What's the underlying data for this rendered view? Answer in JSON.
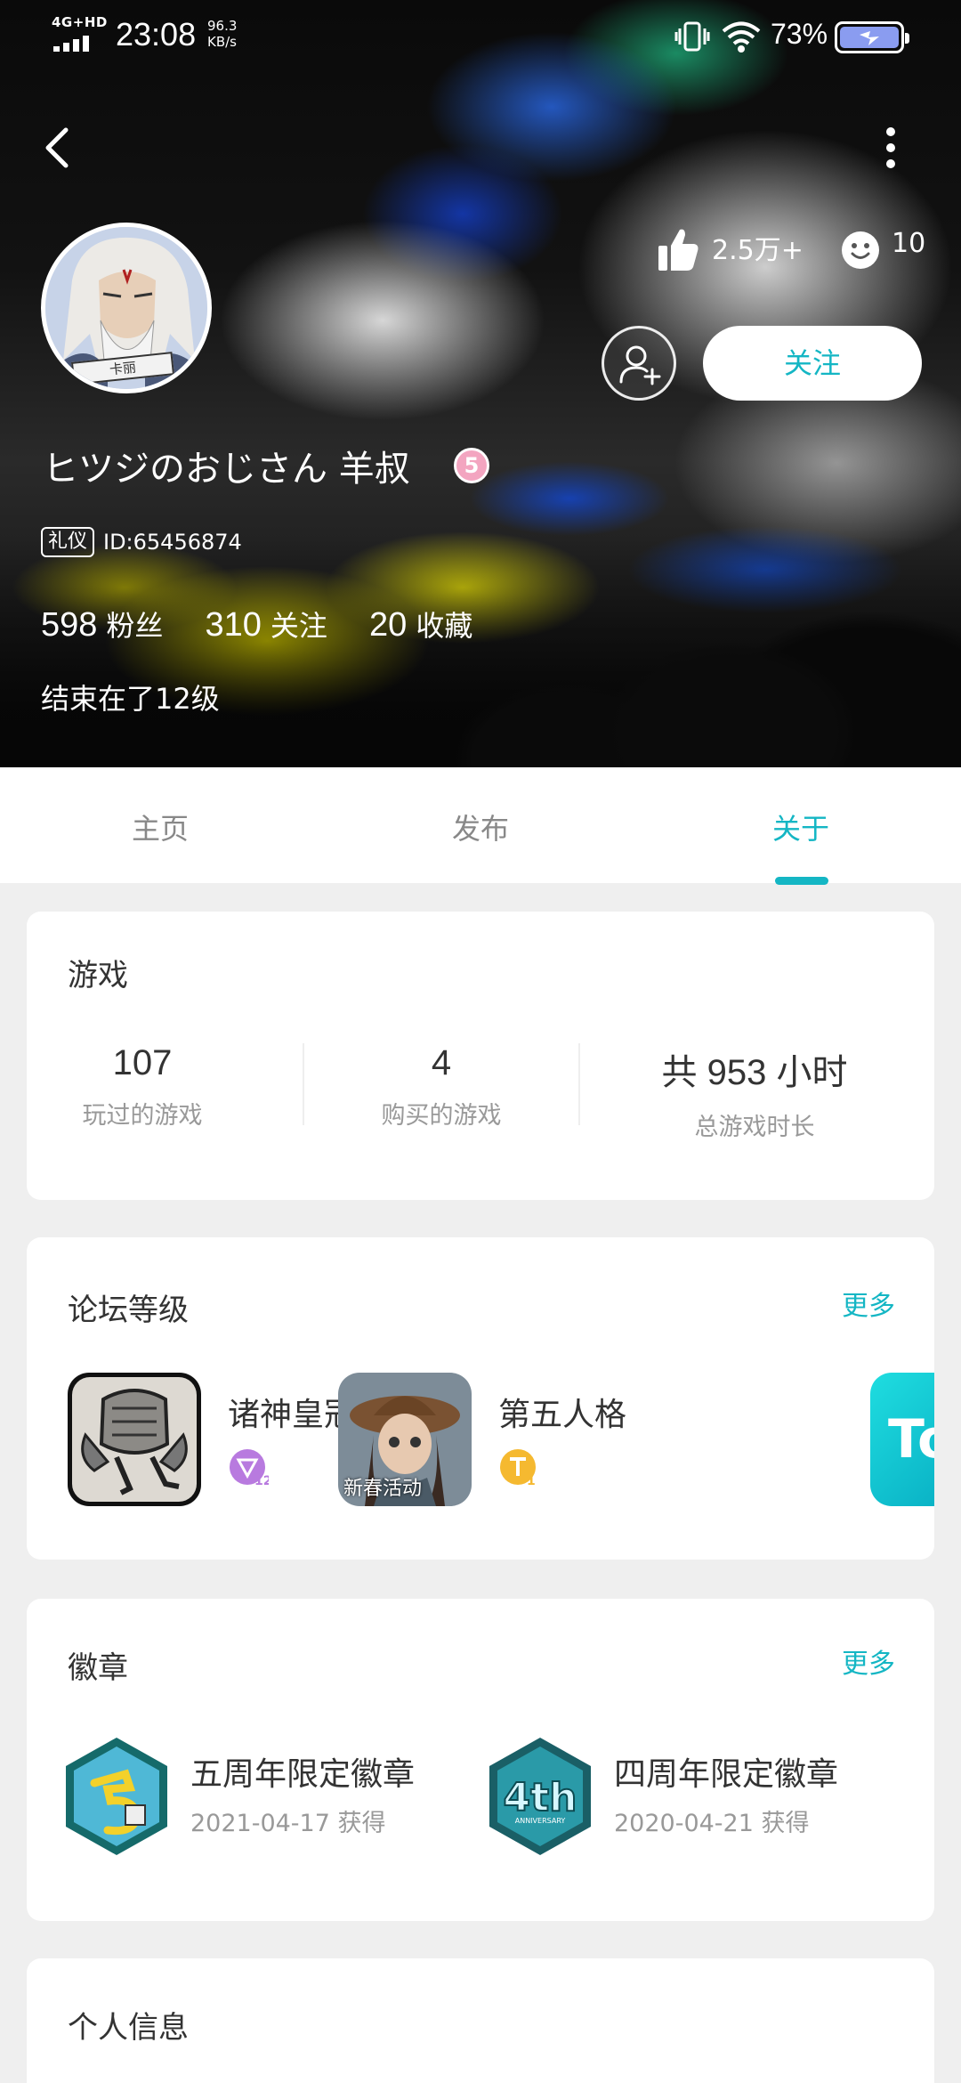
{
  "status_bar": {
    "network": "4G+HD",
    "time": "23:08",
    "speed_value": "96.3",
    "speed_unit": "KB/s",
    "battery": "73%"
  },
  "profile": {
    "likes": "2.5万+",
    "faces": "10",
    "follow_label": "关注",
    "name": "ヒツジのおじさん 羊叔",
    "level": "5",
    "title_badge": "礼仪",
    "user_id": "ID:65456874",
    "avatar_tag": "卡丽",
    "stats": [
      {
        "num": "598",
        "label": "粉丝"
      },
      {
        "num": "310",
        "label": "关注"
      },
      {
        "num": "20",
        "label": "收藏"
      }
    ],
    "bio": "结束在了12级"
  },
  "tabs": [
    {
      "label": "主页",
      "active": false
    },
    {
      "label": "发布",
      "active": false
    },
    {
      "label": "关于",
      "active": true
    }
  ],
  "games": {
    "title": "游戏",
    "stats": [
      {
        "num": "107",
        "label": "玩过的游戏"
      },
      {
        "num": "4",
        "label": "购买的游戏"
      },
      {
        "num": "共 953 小时",
        "label": "总游戏时长"
      }
    ]
  },
  "forum": {
    "title": "论坛等级",
    "more": "更多",
    "items": [
      {
        "name": "诸神皇冠",
        "level": "12",
        "icon": "armor-game-icon"
      },
      {
        "name": "第五人格",
        "level": "1",
        "icon": "identity-v-game-icon",
        "icon_caption": "新春活动"
      }
    ],
    "next_partial": "To"
  },
  "badges": {
    "title": "徽章",
    "more": "更多",
    "items": [
      {
        "name": "五周年限定徽章",
        "date": "2021-04-17 获得",
        "icon": "fifth-anniversary-badge-icon"
      },
      {
        "name": "四周年限定徽章",
        "date": "2020-04-21 获得",
        "icon": "fourth-anniversary-badge-icon",
        "icon_text": "4th",
        "icon_subtext": "ANNIVERSARY"
      }
    ]
  },
  "info": {
    "title": "个人信息"
  },
  "colors": {
    "accent": "#14b6c4",
    "level_badge": "#f3a5c0"
  }
}
